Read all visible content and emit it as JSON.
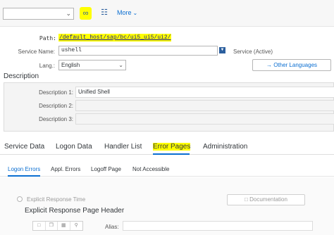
{
  "toolbar": {
    "dropdown_value": "",
    "dropdown_icon": "chevron-down-icon",
    "highlighted_icon": "glasses-display-icon",
    "tree_icon": "hierarchy-icon",
    "more_label": "More"
  },
  "service": {
    "path_label": "Path:",
    "path_value": "/default_host/sap/bc/ui5_ui5/ui2/",
    "name_label": "Service Name:",
    "name_value": "ushell",
    "status": "Service (Active)",
    "lang_label": "Lang.:",
    "lang_value": "English",
    "other_languages_label": "Other Languages"
  },
  "description": {
    "title": "Description",
    "rows": [
      {
        "label": "Description 1:",
        "value": "Unified Shell"
      },
      {
        "label": "Description 2:",
        "value": ""
      },
      {
        "label": "Description 3:",
        "value": ""
      }
    ]
  },
  "tabs": [
    {
      "label": "Service Data"
    },
    {
      "label": "Logon Data"
    },
    {
      "label": "Handler List"
    },
    {
      "label": "Error Pages"
    },
    {
      "label": "Administration"
    }
  ],
  "subtabs": [
    {
      "label": "Logon Errors"
    },
    {
      "label": "Appl. Errors"
    },
    {
      "label": "Logoff Page"
    },
    {
      "label": "Not Accessible"
    }
  ],
  "error_page": {
    "radio_label": "Explicit Response Time",
    "documentation_label": "Documentation",
    "header_title": "Explicit Response Page Header",
    "alias_label": "Alias:",
    "alias_value": ""
  },
  "colors": {
    "highlight": "#ffff00",
    "accent": "#0a6ed1"
  }
}
